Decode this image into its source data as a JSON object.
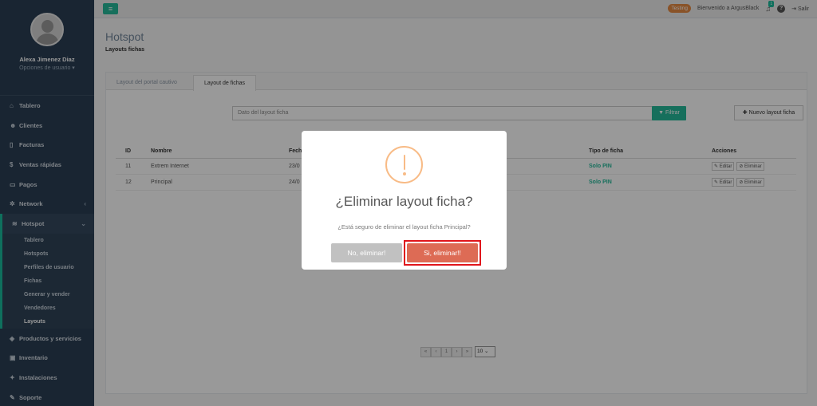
{
  "sidebar": {
    "user_name": "Alexa Jimenez Diaz",
    "user_options": "Opciones de usuario ▾",
    "items": [
      {
        "label": "Tablero",
        "icon": "home-icon"
      },
      {
        "label": "Clientes",
        "icon": "users-icon"
      },
      {
        "label": "Facturas",
        "icon": "file-icon"
      },
      {
        "label": "Ventas rápidas",
        "icon": "dollar-icon"
      },
      {
        "label": "Pagos",
        "icon": "money-icon"
      },
      {
        "label": "Network",
        "icon": "sitemap-icon"
      },
      {
        "label": "Hotspot",
        "icon": "wifi-icon"
      },
      {
        "label": "Productos y servicios",
        "icon": "tag-icon"
      },
      {
        "label": "Inventario",
        "icon": "cubes-icon"
      },
      {
        "label": "Instalaciones",
        "icon": "wrench-icon"
      },
      {
        "label": "Soporte",
        "icon": "support-icon"
      }
    ],
    "hotspot_sub": [
      "Tablero",
      "Hotspots",
      "Perfiles de usuario",
      "Fichas",
      "Generar y vender",
      "Vendedores",
      "Layouts"
    ]
  },
  "topbar": {
    "badge": "Testing",
    "welcome": "Bienvenido a ArgusBlack",
    "notif_count": "1",
    "logout": "Salir"
  },
  "page": {
    "title": "Hotspot",
    "subtitle": "Layouts fichas"
  },
  "tabs": [
    "Layout del portal cautivo",
    "Layout de fichas"
  ],
  "search": {
    "placeholder": "Dato del layout ficha"
  },
  "buttons": {
    "filter": "Filtrar",
    "new": "Nuevo layout ficha",
    "edit": "Editar",
    "delete": "Eliminar"
  },
  "table": {
    "headers": [
      "ID",
      "Nombre",
      "Fech",
      "Tipo de ficha",
      "Acciones"
    ],
    "rows": [
      {
        "id": "11",
        "name": "Extrem Internet",
        "date": "23/0",
        "type": "Solo PIN"
      },
      {
        "id": "12",
        "name": "Principal",
        "date": "24/0",
        "type": "Solo PIN"
      }
    ]
  },
  "pagination": {
    "first": "«",
    "prev": "‹",
    "page": "1",
    "next": "›",
    "last": "»",
    "per_page": "10"
  },
  "modal": {
    "title": "¿Eliminar layout ficha?",
    "text": "¿Está seguro de eliminar el layout ficha Principal?",
    "cancel": "No, eliminar!",
    "confirm": "Si, eliminar!!"
  },
  "colors": {
    "accent": "#26b99a",
    "sidebar": "#2a3f54",
    "confirm": "#dd6b55",
    "warning": "#f8bb86",
    "highlight": "#e0161c"
  }
}
